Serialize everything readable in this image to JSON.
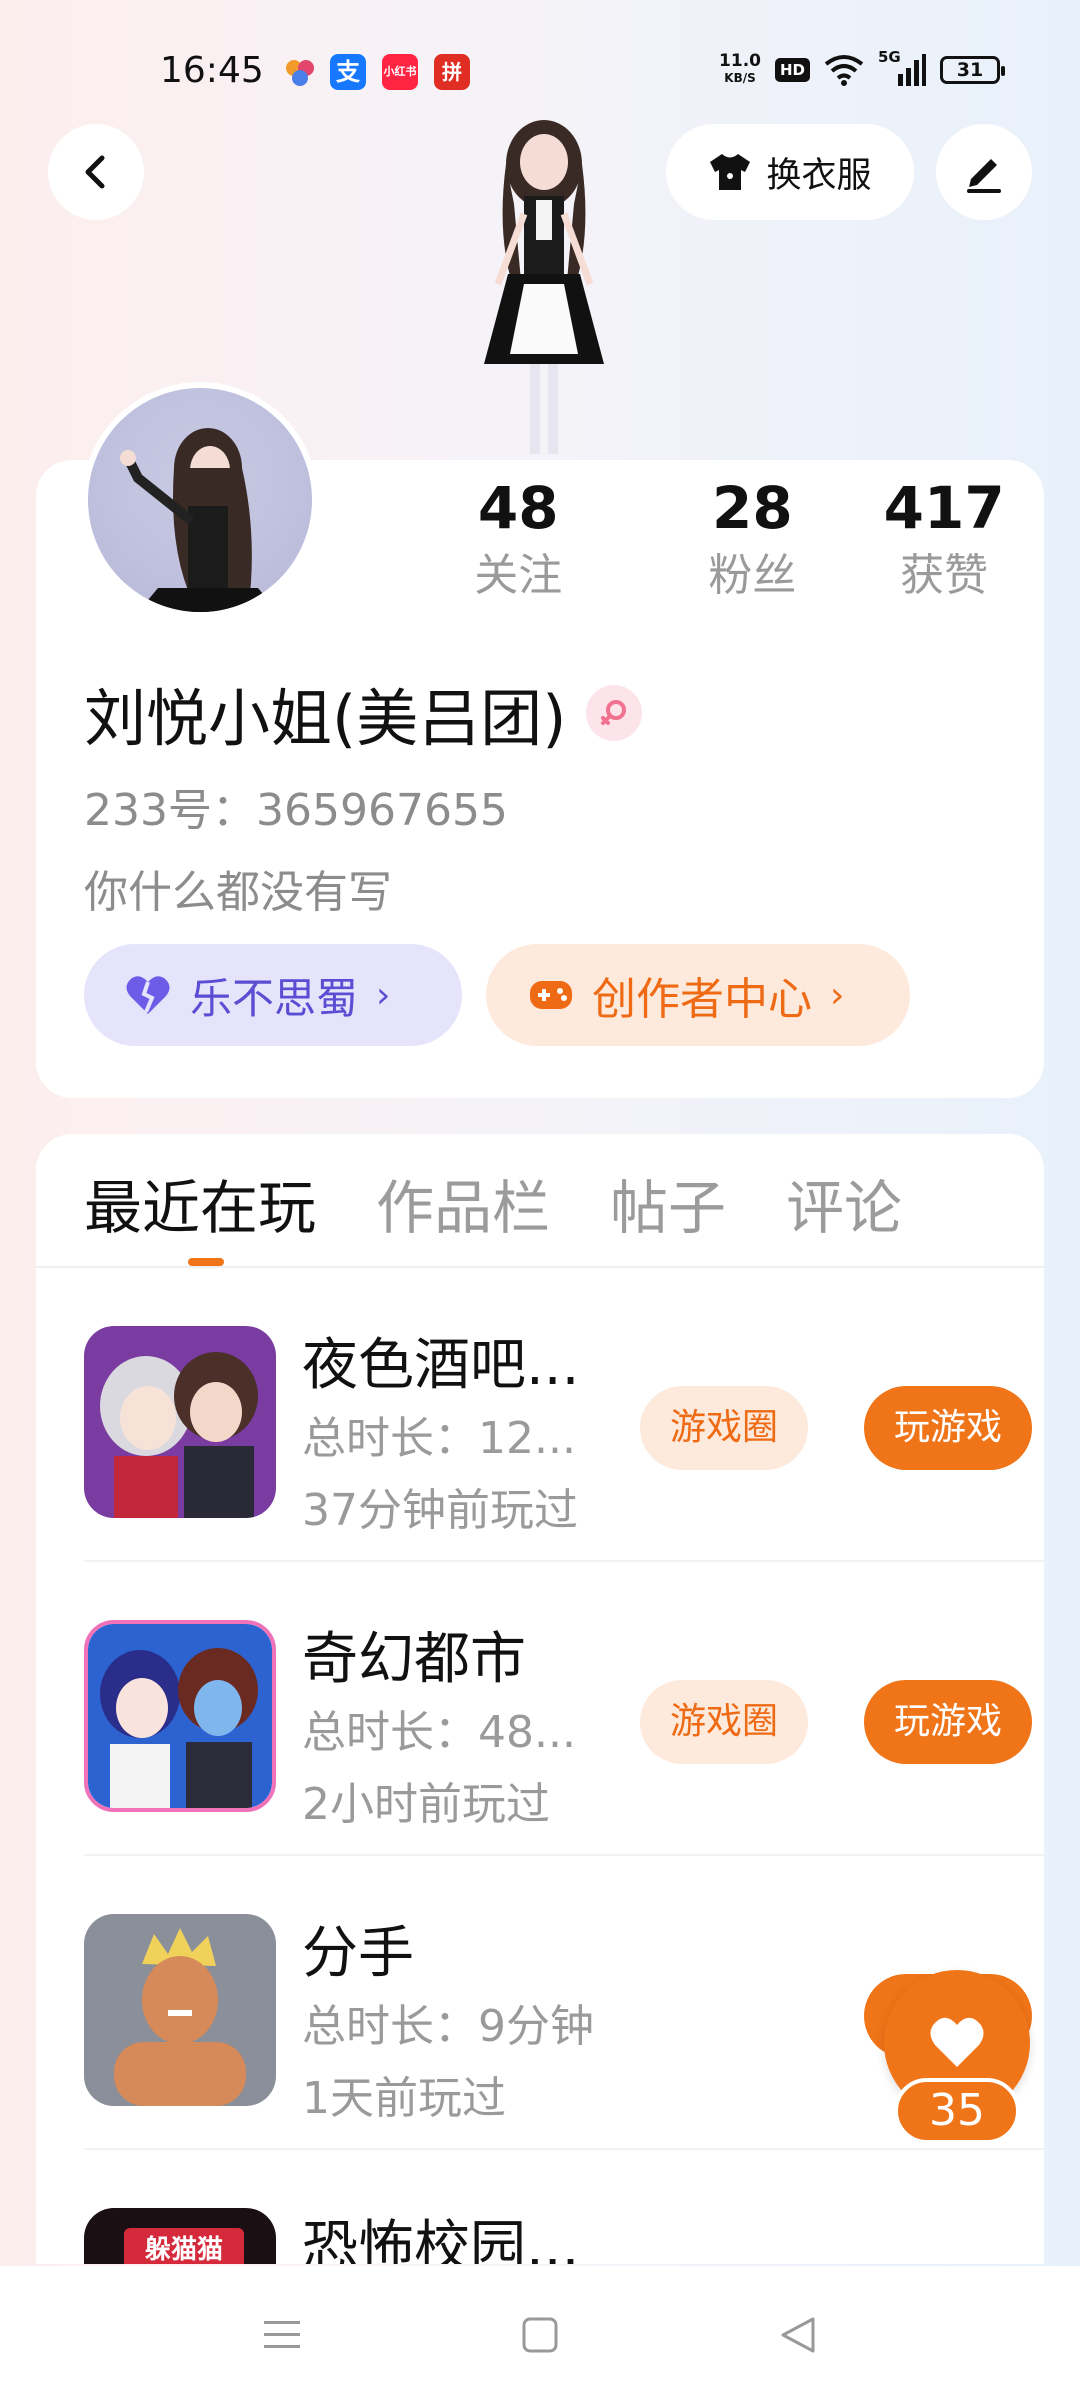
{
  "status_bar": {
    "time": "16:45",
    "network_speed_value": "11.0",
    "network_speed_unit": "KB/S",
    "hd_label": "HD",
    "signal_label": "5G",
    "battery": "31",
    "app_icons": [
      {
        "name": "photo-app-icon",
        "color": "#f29b2c"
      },
      {
        "name": "alipay-icon",
        "color": "#1677ff",
        "glyph": "支"
      },
      {
        "name": "xiaohongshu-icon",
        "color": "#ff2442",
        "glyph": "小红书"
      },
      {
        "name": "pinduoduo-icon",
        "color": "#e02e24",
        "glyph": "拼"
      }
    ]
  },
  "header": {
    "outfit_label": "换衣服"
  },
  "profile": {
    "stats": [
      {
        "value": "48",
        "label": "关注"
      },
      {
        "value": "28",
        "label": "粉丝"
      },
      {
        "value": "417",
        "label": "获赞"
      }
    ],
    "username": "刘悦小姐(美吕团)",
    "user_id": "233号：365967655",
    "bio": "你什么都没有写",
    "group_tag": "乐不思蜀",
    "creator_tag": "创作者中心"
  },
  "tabs": [
    {
      "label": "最近在玩",
      "active": true
    },
    {
      "label": "作品栏",
      "active": false
    },
    {
      "label": "帖子",
      "active": false
    },
    {
      "label": "评论",
      "active": false
    }
  ],
  "games": [
    {
      "title": "夜色酒吧...",
      "duration": "总时长：12...",
      "last_played": "37分钟前玩过",
      "circle_label": "游戏圈",
      "play_label": "玩游戏"
    },
    {
      "title": "奇幻都市",
      "duration": "总时长：48...",
      "last_played": "2小时前玩过",
      "circle_label": "游戏圈",
      "play_label": "玩游戏"
    },
    {
      "title": "分手",
      "duration": "总时长：9分钟",
      "last_played": "1天前玩过",
      "play_label": "玩"
    },
    {
      "title": "恐怖校园..."
    }
  ],
  "game4_icon_text": "躲猫猫",
  "float_like": {
    "count": "35"
  },
  "colors": {
    "accent": "#f07418",
    "group_tag_bg": "#e5e4fb",
    "group_tag_text": "#5b4ed3",
    "creator_bg": "#feeadc"
  }
}
